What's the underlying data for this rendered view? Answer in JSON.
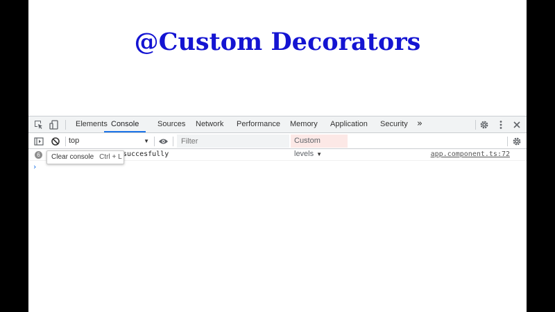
{
  "page": {
    "heading": "@Custom Decorators",
    "heading_color": "#1414d2"
  },
  "devtools": {
    "toolbar_icons": [
      "inspect-element-icon",
      "device-toggle-icon"
    ],
    "tabs": [
      {
        "label": "Elements",
        "active": false
      },
      {
        "label": "Console",
        "active": true
      },
      {
        "label": "Sources",
        "active": false
      },
      {
        "label": "Network",
        "active": false
      },
      {
        "label": "Performance",
        "active": false
      },
      {
        "label": "Memory",
        "active": false
      },
      {
        "label": "Application",
        "active": false
      },
      {
        "label": "Security",
        "active": false
      }
    ],
    "more_tabs": "»",
    "right_icons": [
      "gear-icon",
      "kebab-menu-icon",
      "close-icon"
    ],
    "console_toolbar": {
      "context_value": "top",
      "filter_placeholder": "Filter",
      "levels_label": "Custom levels",
      "icons": [
        "sidebar-toggle-icon",
        "clear-console-icon",
        "eye-icon",
        "gear-icon"
      ]
    },
    "messages": [
      {
        "count": "6",
        "text": "succesfully",
        "source": "app.component.ts:72"
      }
    ],
    "prompt_symbol": "›",
    "tooltip": {
      "label": "Clear console",
      "shortcut": "Ctrl + L"
    },
    "accent_color": "#1a73e8"
  }
}
